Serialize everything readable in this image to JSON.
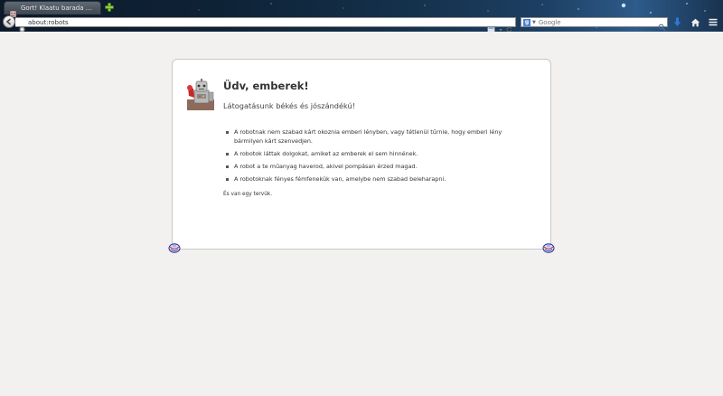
{
  "browser": {
    "tab": {
      "title": "Gort! Klaatu barada ..."
    },
    "address_bar": {
      "url": "about:robots"
    },
    "search_bar": {
      "placeholder": "Google",
      "engine_icon": "g-icon"
    }
  },
  "page": {
    "heading": "Üdv, emberek!",
    "subheading": "Látogatásunk békés és jószándékú!",
    "laws": [
      "A robotnak nem szabad kárt okoznia emberi lényben, vagy tétlenül tűrnie, hogy emberi lény bármilyen kárt szenvedjen.",
      "A robotok láttak dolgokat, amiket az emberek el sem hinnének.",
      "A robot a te műanyag haverod, akivel pompásan érzed magad.",
      "A robotoknak fényes fémfenekük van, amelybe nem szabad beleharapni."
    ],
    "footnote": "És van egy tervük."
  },
  "colors": {
    "page_background": "#f2f1f0",
    "card_background": "#ffffff",
    "card_border": "#c8c8c8",
    "download_arrow": "#2b7ad8"
  }
}
